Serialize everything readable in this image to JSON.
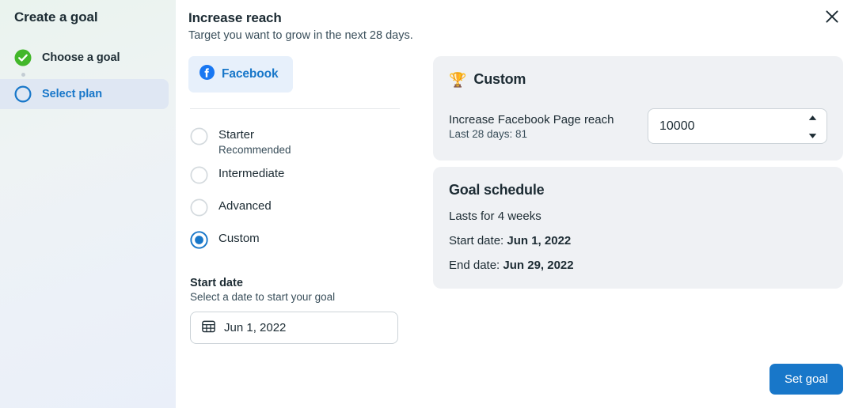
{
  "sidebar": {
    "title": "Create a goal",
    "steps": [
      {
        "label": "Choose a goal",
        "state": "completed",
        "icon": "check-circle-icon"
      },
      {
        "label": "Select plan",
        "state": "active",
        "icon": "circle-outline-icon"
      }
    ]
  },
  "header": {
    "title": "Increase reach",
    "subtitle": "Target you want to grow in the next 28 days.",
    "close_icon": "close-icon"
  },
  "source_tab": {
    "label": "Facebook",
    "icon": "facebook-icon"
  },
  "plans": {
    "options": [
      {
        "label": "Starter",
        "sub": "Recommended",
        "selected": false
      },
      {
        "label": "Intermediate",
        "sub": "",
        "selected": false
      },
      {
        "label": "Advanced",
        "sub": "",
        "selected": false
      },
      {
        "label": "Custom",
        "sub": "",
        "selected": true
      }
    ]
  },
  "start_date": {
    "title": "Start date",
    "subtitle": "Select a date to start your goal",
    "value": "Jun 1, 2022",
    "icon": "calendar-icon"
  },
  "custom_card": {
    "icon": "trophy-icon",
    "trophy_glyph": "🏆",
    "title": "Custom",
    "metric_name": "Increase Facebook Page reach",
    "metric_sub": "Last 28 days: 81",
    "target_value": "10000"
  },
  "schedule_card": {
    "title": "Goal schedule",
    "duration": "Lasts for 4 weeks",
    "start_label": "Start date: ",
    "start_value": "Jun 1, 2022",
    "end_label": "End date: ",
    "end_value": "Jun 29, 2022"
  },
  "footer": {
    "set_goal_label": "Set goal"
  },
  "colors": {
    "accent_blue": "#1877c9",
    "facebook_blue": "#1877f2",
    "success_green": "#42b72a",
    "card_bg": "#eff1f4",
    "active_step_bg": "#dfe7f3",
    "text_dark": "#1c2b33"
  }
}
